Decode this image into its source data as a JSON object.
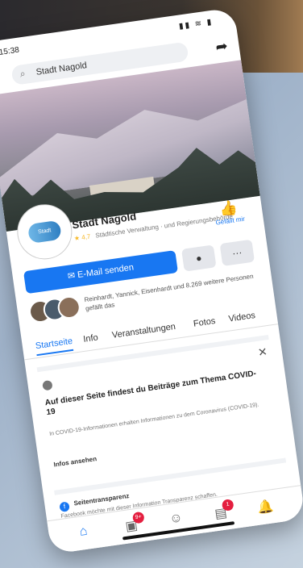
{
  "status": {
    "time": "15:38",
    "icons": "▮▮ ≋ ▮"
  },
  "search": {
    "query": "Stadt Nagold"
  },
  "page": {
    "name": "Stadt Nagold",
    "rating": "★ 4,7",
    "category_line": "Städtische Verwaltung · und Regierungsbehörde",
    "liked_label": "Gefällt mir",
    "profile_logo_text": "Stadt Nagold"
  },
  "actions": {
    "message_label": "E-Mail senden",
    "more_label": "···"
  },
  "friends": {
    "text": "Reinhardt, Yannick, Eisenhardt und 8.269 weitere Personen gefällt das"
  },
  "tabs": [
    "Startseite",
    "Info",
    "Veranstaltungen",
    "Fotos",
    "Videos"
  ],
  "card": {
    "title": "Auf dieser Seite findest du Beiträge zum Thema COVID-19",
    "body": "In COVID-19-Informationen erhalten Informationen zu dem Coronavirus (COVID-19).",
    "link": "Infos ansehen"
  },
  "promo": {
    "title": "Seitentransparenz",
    "subtitle": "Facebook möchte mit dieser Information Transparenz schaffen."
  },
  "bottom_nav": {
    "items": [
      "home-icon",
      "video-icon",
      "marketplace-icon",
      "groups-icon",
      "bell-icon"
    ],
    "badges": [
      "",
      "9+",
      "",
      "1",
      ""
    ]
  }
}
